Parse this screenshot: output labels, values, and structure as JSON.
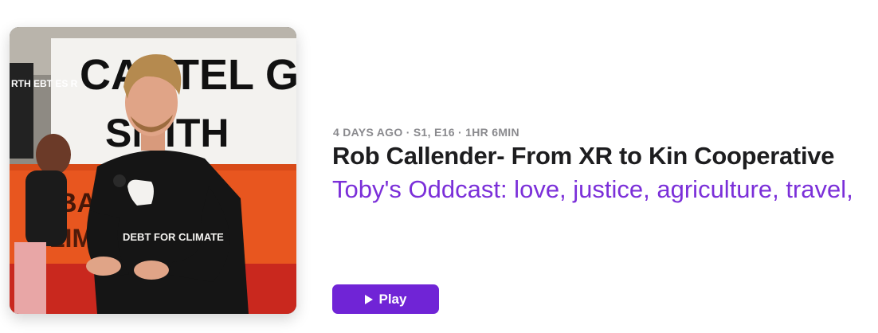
{
  "episode": {
    "meta": "4 DAYS AGO · S1, E16 · 1HR 6MIN",
    "title": "Rob Callender- From XR to Kin Cooperative",
    "show_name": "Toby's Oddcast: love, justice, agriculture, travel,",
    "play_label": "Play"
  },
  "artwork": {
    "banner_top_text": "CARTEL G",
    "banner_top_text2": "SMITH",
    "banner_orange_text": "BAN ... DRIV",
    "banner_orange_text2": "LIMI ... SSIS",
    "shirt_text": "DEBT FOR CLIMATE",
    "left_sign_text": "RTH EBT ES R"
  },
  "colors": {
    "accent": "#7024d6",
    "show_name": "#7b2fd9",
    "meta": "#8a8a8e",
    "title": "#1d1d1f"
  }
}
